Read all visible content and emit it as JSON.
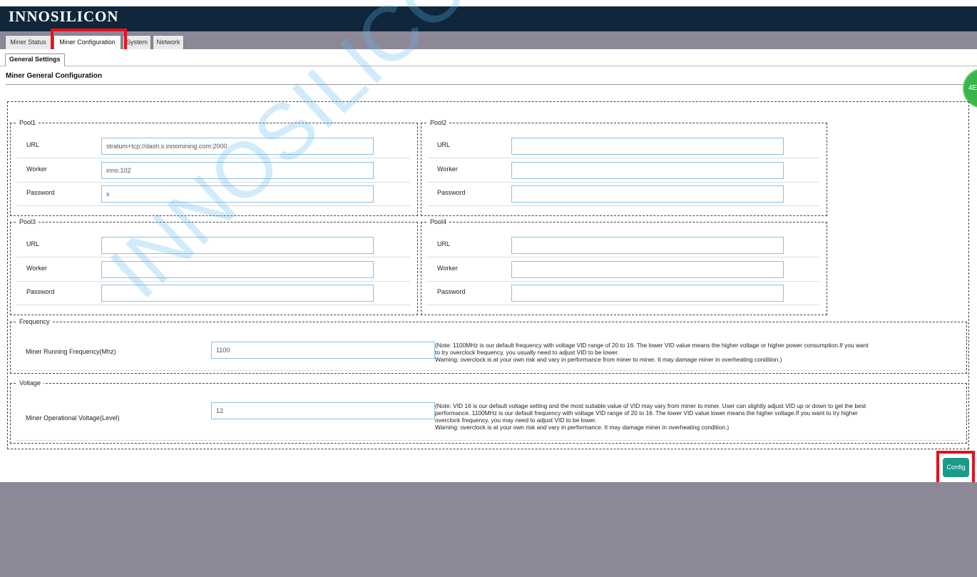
{
  "app": {
    "brand": "INNOSILICON"
  },
  "tabs": [
    {
      "label": "Miner Status",
      "active": false
    },
    {
      "label": "Miner Configuration",
      "active": true
    },
    {
      "label": "System",
      "active": false
    },
    {
      "label": "Network",
      "active": false
    }
  ],
  "subtab": {
    "label": "General Settings"
  },
  "section": {
    "title": "Miner General Configuration"
  },
  "labels": {
    "url": "URL",
    "worker": "Worker",
    "password": "Password"
  },
  "pools": [
    {
      "legend": "Pool1",
      "url": "stratum+tcp://dash.s.innomining.com:2000",
      "worker": "inno.102",
      "password": "x"
    },
    {
      "legend": "Pool2",
      "url": "",
      "worker": "",
      "password": ""
    },
    {
      "legend": "Pool3",
      "url": "",
      "worker": "",
      "password": ""
    },
    {
      "legend": "Pool4",
      "url": "",
      "worker": "",
      "password": ""
    }
  ],
  "frequency": {
    "legend": "Frequency",
    "label": "Miner Running Frequency(Mhz)",
    "value": "1100",
    "note_lines": [
      "(Note: 1100MHz is our default frequency with voltage VID range of 20 to 16. The lower VID value means the higher voltage or higher power consumption.If you want",
      "to try overclock frequency, you usually need to adjust VID to be lower.",
      "Warning: overclock is at your own risk and vary in performance from miner to miner. It may damage miner in overheating condition.)"
    ]
  },
  "voltage": {
    "legend": "Voltage",
    "label": "Miner Operational Voltage(Level)",
    "value": "12",
    "note_lines": [
      "(Note: VID 16 is our default voltage setting and the most suitable value of VID may vary from miner to miner. User can slightly adjust VID up or down to get the best",
      "performance. 1100MHz is our default frequency with voltage VID range of 20 to 16. The lower VID value lower means the higher voltage.If you want to try higher",
      "overclock frequency, you may need to adjust VID to be lower.",
      "Warning: overclock is at your own risk and vary in performance. It may damage miner in overheating condition.)"
    ]
  },
  "buttons": {
    "config": "Config",
    "side_green": "4E"
  },
  "watermark": "INNOSILICON CONFIDENTIAL",
  "colors": {
    "header_bg": "#10263a",
    "chrome_gray": "#8c8898",
    "highlight": "#e8101a",
    "config_button": "#1b9b8a",
    "input_border": "#8bbfe8"
  }
}
